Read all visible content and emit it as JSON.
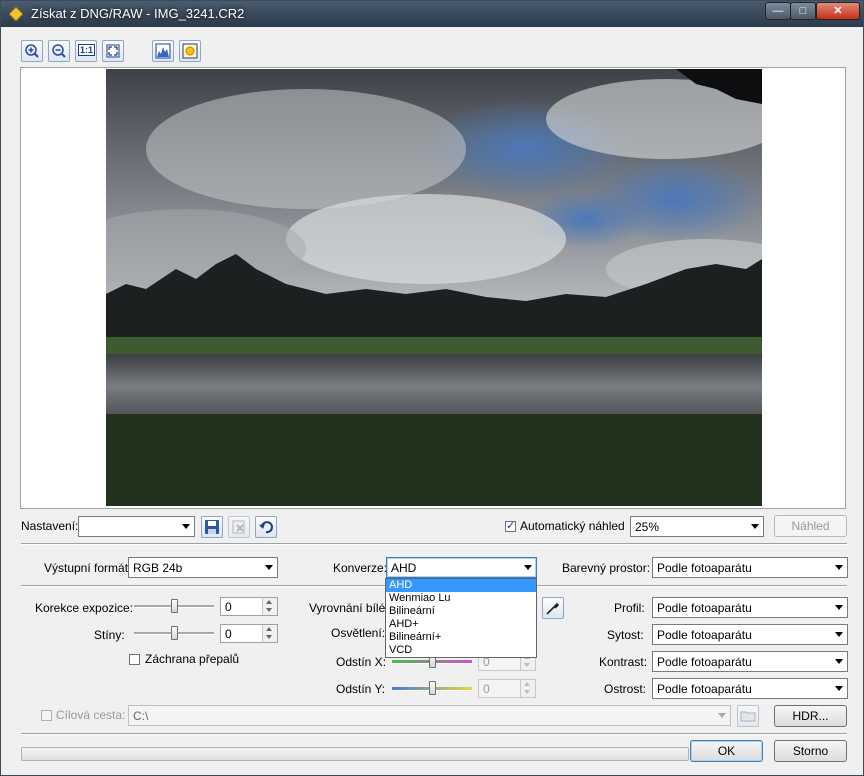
{
  "window": {
    "title": "Získat z DNG/RAW - IMG_3241.CR2",
    "controls": {
      "minimize": "—",
      "maximize": "□",
      "close": "✕"
    }
  },
  "toolbar": {
    "buttons": [
      {
        "name": "zoom-in-icon",
        "label": ""
      },
      {
        "name": "zoom-out-icon",
        "label": ""
      },
      {
        "name": "actual-size-icon",
        "label": "1:1"
      },
      {
        "name": "fit-to-window-icon",
        "label": ""
      },
      {
        "name": "histogram-icon",
        "label": ""
      },
      {
        "name": "exposure-icon",
        "label": ""
      }
    ]
  },
  "preset": {
    "label": "Nastavení:",
    "value": "",
    "auto_preview_label": "Automatický náhled",
    "auto_preview_checked": true,
    "zoom_value": "25%",
    "preview_button": "Náhled"
  },
  "output": {
    "format_label": "Výstupní formát:",
    "format_value": "RGB 24b",
    "conversion_label": "Konverze:",
    "conversion_value": "AHD",
    "conversion_options": [
      "AHD",
      "Wenmiao Lu",
      "Bilineární",
      "AHD+",
      "Bilineární+",
      "VCD"
    ],
    "colorspace_label": "Barevný prostor:",
    "colorspace_value": "Podle fotoaparátu"
  },
  "adjustments": {
    "exposure_label": "Korekce expozice:",
    "exposure_value": "0",
    "exposure_level": 0.5,
    "shadows_label": "Stíny:",
    "shadows_value": "0",
    "shadows_level": 0.5,
    "highlight_recovery_label": "Záchrana přepalů",
    "highlight_recovery_checked": false,
    "white_balance_label": "Vyrovnání bílé:",
    "lighting_label": "Osvětlení:",
    "tint_x_label": "Odstín X:",
    "tint_x_value": "0",
    "tint_x_level": 0.5,
    "tint_y_label": "Odstín Y:",
    "tint_y_value": "0",
    "tint_y_level": 0.5,
    "profile_label": "Profil:",
    "profile_value": "Podle fotoaparátu",
    "saturation_label": "Sytost:",
    "saturation_value": "Podle fotoaparátu",
    "contrast_label": "Kontrast:",
    "contrast_value": "Podle fotoaparátu",
    "sharpness_label": "Ostrost:",
    "sharpness_value": "Podle fotoaparátu"
  },
  "target": {
    "label": "Cílová cesta:",
    "checked": false,
    "path": "C:\\",
    "hdr_button": "HDR..."
  },
  "footer": {
    "ok": "OK",
    "cancel": "Storno",
    "progress": 0
  }
}
